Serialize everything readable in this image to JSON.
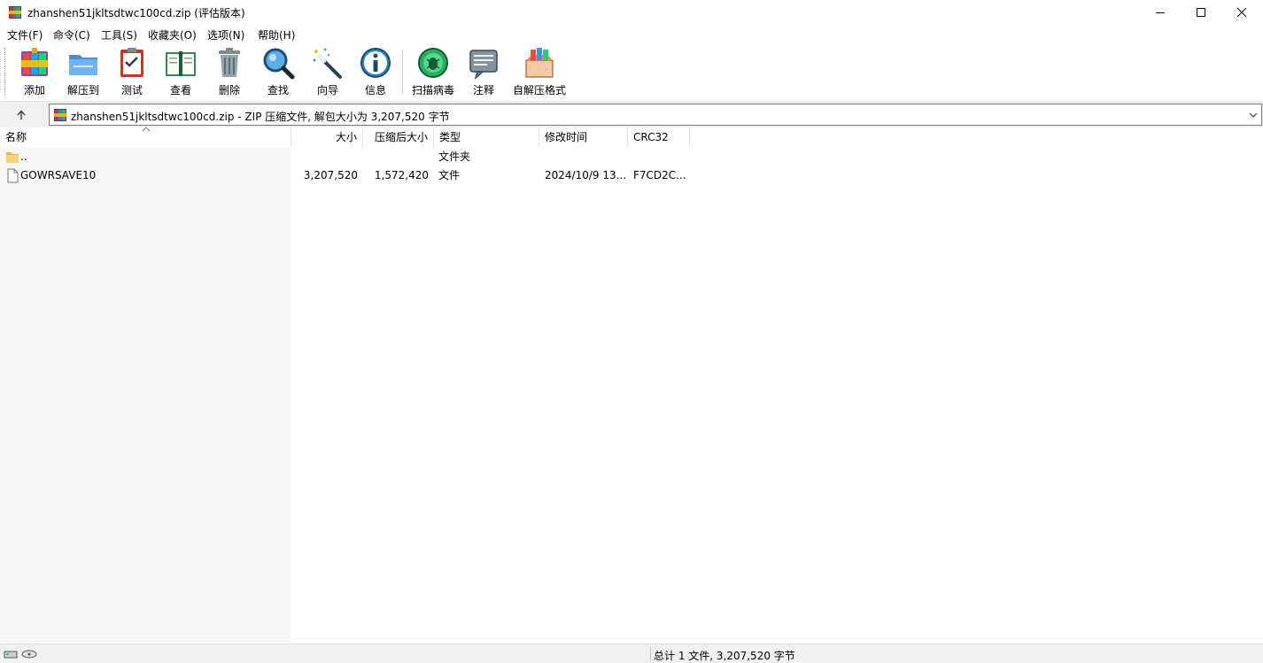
{
  "window": {
    "title": "zhanshen51jkltsdtwc100cd.zip (评估版本)",
    "controls": [
      "minimize",
      "maximize",
      "close"
    ]
  },
  "menu": [
    "文件(F)",
    "命令(C)",
    "工具(S)",
    "收藏夹(O)",
    "选项(N)",
    "帮助(H)"
  ],
  "toolbar": {
    "buttons": [
      {
        "label": "添加",
        "icon": "add-archive-icon"
      },
      {
        "label": "解压到",
        "icon": "extract-to-folder-icon"
      },
      {
        "label": "测试",
        "icon": "test-clipboard-icon"
      },
      {
        "label": "查看",
        "icon": "view-book-icon"
      },
      {
        "label": "删除",
        "icon": "delete-trash-icon"
      },
      {
        "label": "查找",
        "icon": "find-magnifier-icon"
      },
      {
        "label": "向导",
        "icon": "wizard-wand-icon"
      },
      {
        "label": "信息",
        "icon": "info-icon"
      },
      {
        "label": "扫描病毒",
        "icon": "virus-scan-icon"
      },
      {
        "label": "注释",
        "icon": "comment-icon"
      },
      {
        "label": "自解压格式",
        "icon": "sfx-box-icon"
      }
    ]
  },
  "address": {
    "text": "zhanshen51jkltsdtwc100cd.zip - ZIP 压缩文件, 解包大小为 3,207,520 字节"
  },
  "columns": {
    "name": "名称",
    "size": "大小",
    "packed": "压缩后大小",
    "type": "类型",
    "modified": "修改时间",
    "crc": "CRC32"
  },
  "files": [
    {
      "name": "..",
      "size": "",
      "packed": "",
      "type": "文件夹",
      "modified": "",
      "crc": "",
      "icon": "folder-icon"
    },
    {
      "name": "GOWRSAVE10",
      "size": "3,207,520",
      "packed": "1,572,420",
      "type": "文件",
      "modified": "2024/10/9 13...",
      "crc": "F7CD2C...",
      "icon": "file-icon"
    }
  ],
  "status": {
    "summary": "总计 1 文件, 3,207,520 字节"
  },
  "colors": {
    "accent_toolbar_separator": "#c8c8c8",
    "name_column_shade": "#f7f7f7",
    "statusbar_bg": "#f0f0f0"
  }
}
